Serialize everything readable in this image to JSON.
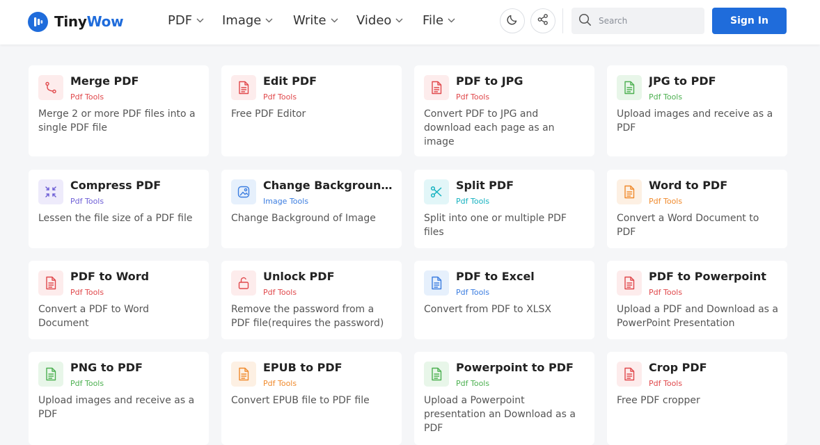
{
  "header": {
    "logo": {
      "text_main": "Tiny",
      "text_accent": "Wow"
    },
    "nav": [
      {
        "label": "PDF"
      },
      {
        "label": "Image"
      },
      {
        "label": "Write"
      },
      {
        "label": "Video"
      },
      {
        "label": "File"
      }
    ],
    "search": {
      "placeholder": "Search"
    },
    "signin_label": "Sign In"
  },
  "colors": {
    "brand": "#1f6cdb",
    "pdf_red": "#e0484b",
    "pdf_bg": "#fdecec",
    "green": "#4cb050",
    "green_bg": "#e8f6e9",
    "orange": "#f08a2c",
    "orange_bg": "#fdf0e3",
    "purple": "#6e5fd6",
    "purple_bg": "#eeebfb",
    "blue": "#3b7de0",
    "blue_bg": "#e6f0fc",
    "teal": "#16b2c0",
    "teal_bg": "#e2f6f8"
  },
  "cards": [
    {
      "title": "Merge PDF",
      "category": "Pdf Tools",
      "desc": "Merge 2 or more PDF files into a single PDF file",
      "icon": "merge-icon",
      "theme": "red"
    },
    {
      "title": "Edit PDF",
      "category": "Pdf Tools",
      "desc": "Free PDF Editor",
      "icon": "document-icon",
      "theme": "red"
    },
    {
      "title": "PDF to JPG",
      "category": "Pdf Tools",
      "desc": "Convert PDF to JPG and download each page as an image",
      "icon": "document-icon",
      "theme": "red"
    },
    {
      "title": "JPG to PDF",
      "category": "Pdf Tools",
      "desc": "Upload images and receive as a PDF",
      "icon": "document-icon",
      "theme": "green"
    },
    {
      "title": "Compress PDF",
      "category": "Pdf Tools",
      "desc": "Lessen the file size of a PDF file",
      "icon": "compress-icon",
      "theme": "purple"
    },
    {
      "title": "Change Background of Image",
      "category": "Image Tools",
      "desc": "Change Background of Image",
      "icon": "image-icon",
      "theme": "blue"
    },
    {
      "title": "Split PDF",
      "category": "Pdf Tools",
      "desc": "Split into one or multiple PDF files",
      "icon": "scissors-icon",
      "theme": "teal"
    },
    {
      "title": "Word to PDF",
      "category": "Pdf Tools",
      "desc": "Convert a Word Document to PDF",
      "icon": "document-icon",
      "theme": "orange"
    },
    {
      "title": "PDF to Word",
      "category": "Pdf Tools",
      "desc": "Convert a PDF to Word Document",
      "icon": "document-icon",
      "theme": "red"
    },
    {
      "title": "Unlock PDF",
      "category": "Pdf Tools",
      "desc": "Remove the password from a PDF file(requires the password)",
      "icon": "unlock-icon",
      "theme": "red"
    },
    {
      "title": "PDF to Excel",
      "category": "Pdf Tools",
      "desc": "Convert from PDF to XLSX",
      "icon": "document-icon",
      "theme": "blue"
    },
    {
      "title": "PDF to Powerpoint",
      "category": "Pdf Tools",
      "desc": "Upload a PDF and Download as a PowerPoint Presentation",
      "icon": "document-icon",
      "theme": "red"
    },
    {
      "title": "PNG to PDF",
      "category": "Pdf Tools",
      "desc": "Upload images and receive as a PDF",
      "icon": "document-icon",
      "theme": "green"
    },
    {
      "title": "EPUB to PDF",
      "category": "Pdf Tools",
      "desc": "Convert EPUB file to PDF file",
      "icon": "document-icon",
      "theme": "orange"
    },
    {
      "title": "Powerpoint to PDF",
      "category": "Pdf Tools",
      "desc": "Upload a Powerpoint presentation an Download as a PDF",
      "icon": "document-icon",
      "theme": "green"
    },
    {
      "title": "Crop PDF",
      "category": "Pdf Tools",
      "desc": "Free PDF cropper",
      "icon": "document-icon",
      "theme": "red"
    }
  ]
}
